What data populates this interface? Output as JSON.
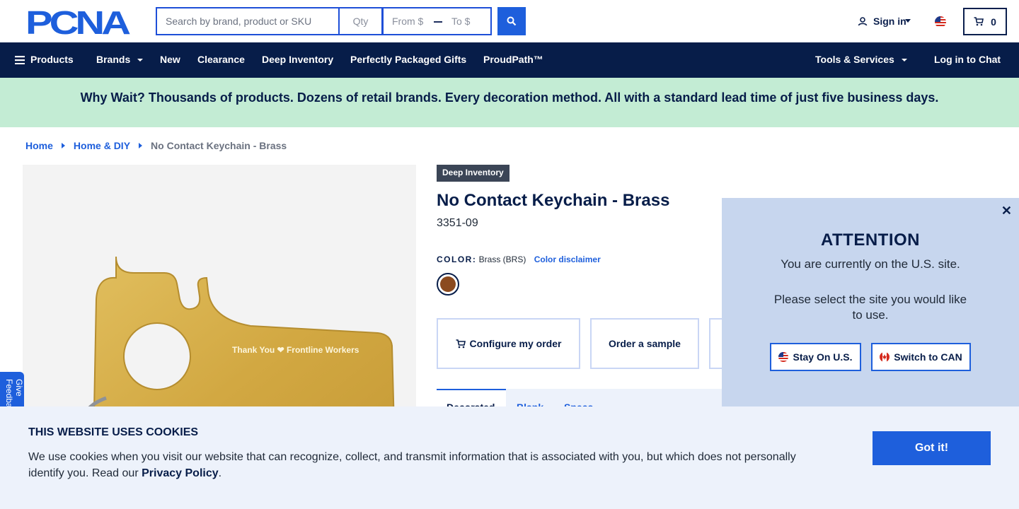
{
  "header": {
    "logo_text": "PCNA",
    "search_placeholder": "Search by brand, product or SKU",
    "qty_placeholder": "Qty",
    "from_placeholder": "From $",
    "to_placeholder": "To $",
    "signin_label": "Sign in",
    "cart_count": "0"
  },
  "nav": {
    "products": "Products",
    "brands": "Brands",
    "new": "New",
    "clearance": "Clearance",
    "deep_inventory": "Deep Inventory",
    "packaged_gifts": "Perfectly Packaged Gifts",
    "proudpath": "ProudPath™",
    "tools": "Tools & Services",
    "chat": "Log in to Chat"
  },
  "banner": {
    "text": "Why Wait? Thousands of products. Dozens of retail brands. Every decoration method. All with a standard lead time of just five business days."
  },
  "breadcrumb": {
    "home": "Home",
    "category": "Home & DIY",
    "current": "No Contact Keychain - Brass"
  },
  "product": {
    "badge": "Deep Inventory",
    "title": "No Contact Keychain - Brass",
    "sku": "3351-09",
    "color_label": "COLOR:",
    "color_value": "Brass (BRS)",
    "color_disclaimer": "Color disclaimer",
    "swatch_color": "#8b4a1f",
    "engraving_text": "Thank You ❤ Frontline Workers",
    "configure_label": "Configure my order",
    "sample_label": "Order a sample",
    "tab_active": "Decorated",
    "tab_second": "Blank",
    "tab_third": "Specs",
    "feedback_label": "Give Feedback"
  },
  "modal": {
    "heading": "ATTENTION",
    "line1": "You are currently on the U.S. site.",
    "line2": "Please select the site you would like to use.",
    "stay_label": "Stay On U.S.",
    "switch_label": "Switch to CAN"
  },
  "cookie": {
    "title": "THIS WEBSITE USES COOKIES",
    "text": "We use cookies when you visit our website that can recognize, collect, and transmit information that is associated with you, but which does not personally identify you. Read our",
    "policy_link": "Privacy Policy",
    "period": ".",
    "accept_label": "Got it!"
  },
  "colors": {
    "navy": "#071d49",
    "accent_blue": "#1e5fdc",
    "banner_green": "#c3ecd4",
    "modal_bg": "#c7d6ee"
  }
}
